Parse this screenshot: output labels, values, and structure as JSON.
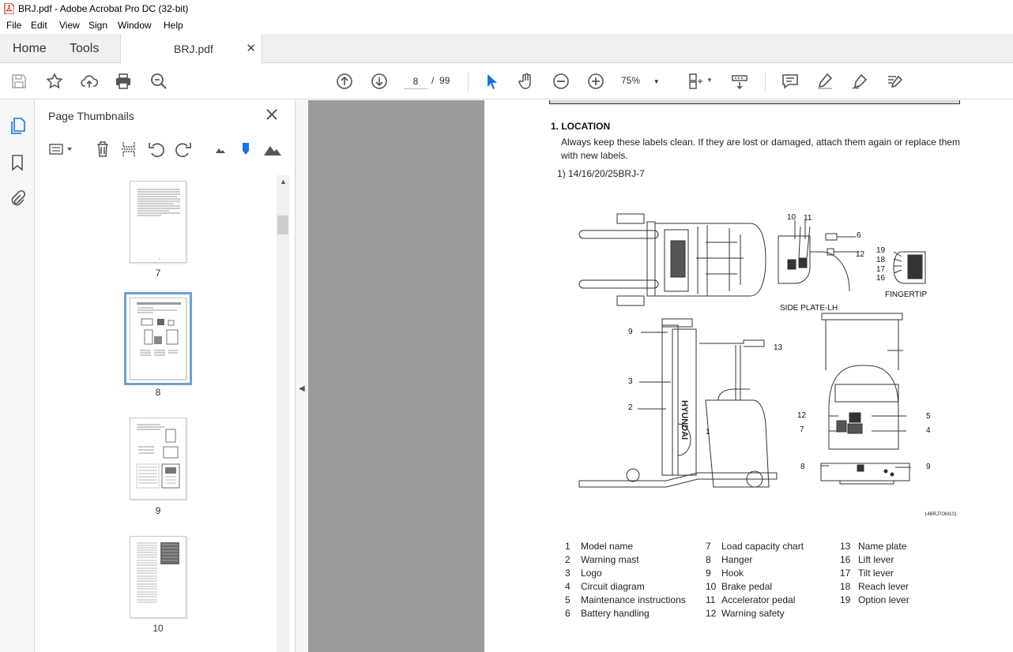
{
  "window": {
    "title": "BRJ.pdf - Adobe Acrobat Pro DC (32-bit)"
  },
  "menu": [
    "File",
    "Edit",
    "View",
    "Sign",
    "Window",
    "Help"
  ],
  "tabs": {
    "home": "Home",
    "tools": "Tools",
    "document": "BRJ.pdf"
  },
  "toolbar": {
    "page_current": "8",
    "page_sep": "/",
    "page_total": "99",
    "zoom": "75%"
  },
  "panel": {
    "title": "Page Thumbnails",
    "thumb_labels": [
      "7",
      "8",
      "9",
      "10"
    ],
    "selected_page": "8"
  },
  "document": {
    "heading": "1. LOCATION",
    "paragraph": "Always keep these labels clean.  If they are lost or damaged, attach them again or replace them with new labels.",
    "subheading": "1) 14/16/20/25BRJ-7",
    "fig_code": "14BRJ7OM101",
    "captions": {
      "side_plate": "SIDE PLATE-LH",
      "fingertip": "FINGERTIP"
    },
    "callouts": [
      "10",
      "11",
      "6",
      "12",
      "19",
      "18",
      "17",
      "16",
      "9",
      "13",
      "3",
      "2",
      "1",
      "12",
      "5",
      "7",
      "4",
      "8",
      "9"
    ],
    "legend_col1": [
      {
        "num": "1",
        "label": "Model name"
      },
      {
        "num": "2",
        "label": "Warning mast"
      },
      {
        "num": "3",
        "label": "Logo"
      },
      {
        "num": "4",
        "label": "Circuit diagram"
      },
      {
        "num": "5",
        "label": "Maintenance instructions"
      },
      {
        "num": "6",
        "label": "Battery handling"
      }
    ],
    "legend_col2": [
      {
        "num": "7",
        "label": "Load capacity chart"
      },
      {
        "num": "8",
        "label": "Hanger"
      },
      {
        "num": "9",
        "label": "Hook"
      },
      {
        "num": "10",
        "label": "Brake pedal"
      },
      {
        "num": "11",
        "label": "Accelerator pedal"
      },
      {
        "num": "12",
        "label": "Warning safety"
      }
    ],
    "legend_col3": [
      {
        "num": "13",
        "label": "Name plate"
      },
      {
        "num": "16",
        "label": "Lift lever"
      },
      {
        "num": "17",
        "label": "Tilt lever"
      },
      {
        "num": "18",
        "label": "Reach lever"
      },
      {
        "num": "19",
        "label": "Option lever"
      }
    ]
  },
  "colors": {
    "accent_blue": "#1473e6",
    "pdf_red": "#d9201e",
    "canvas_gray": "#9b9b9b"
  }
}
